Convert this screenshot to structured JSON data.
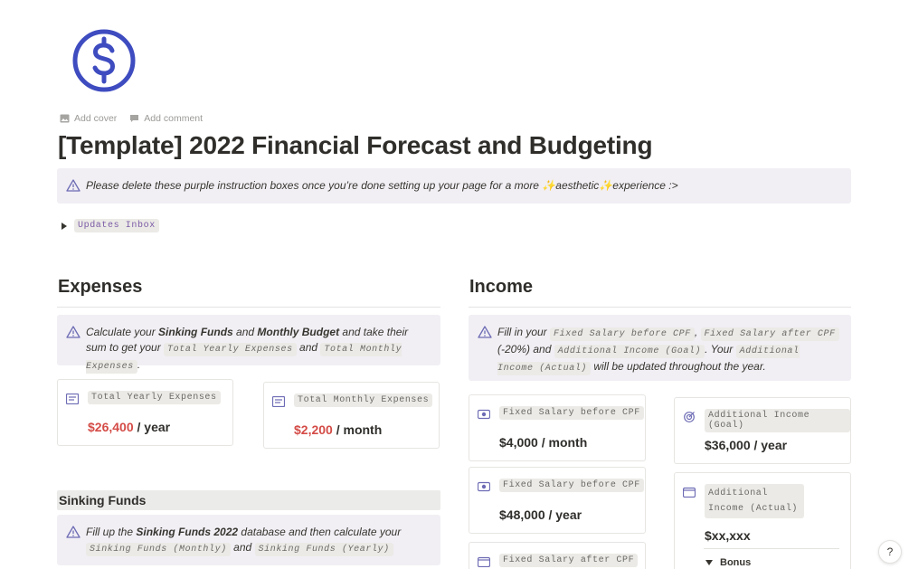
{
  "page": {
    "icon": "dollar-circle-icon",
    "add_cover": "Add cover",
    "add_comment": "Add comment",
    "title": "[Template] 2022 Financial Forecast and Budgeting"
  },
  "top_callout": {
    "icon": "warning-triangle-icon",
    "text_a": "Please delete these purple instruction boxes once you’re done setting up your page for a more ",
    "sparkle_a": "✨",
    "text_b": "aesthetic",
    "sparkle_b": "✨",
    "text_c": "experience :>"
  },
  "toggle": {
    "label": "Updates Inbox"
  },
  "expenses": {
    "heading": "Expenses",
    "callout": {
      "p1": "Calculate your ",
      "b1": "Sinking Funds",
      "p2": " and ",
      "b2": "Monthly Budget",
      "p3": " and take their sum to get your ",
      "c1": "Total Yearly Expenses",
      "p4": " and ",
      "c2": "Total Monthly Expenses",
      "p5": "."
    },
    "cards": [
      {
        "label": "Total Yearly Expenses",
        "amount": "$26,400",
        "unit": " / year",
        "icon": "notes-icon"
      },
      {
        "label": "Total Monthly Expenses",
        "amount": "$2,200",
        "unit": " / month",
        "icon": "notes-icon"
      }
    ]
  },
  "sinking_funds": {
    "heading": "Sinking Funds",
    "callout": {
      "p1": "Fill up the ",
      "b1": "Sinking Funds 2022",
      "p2": " database and then calculate your ",
      "c1": "Sinking Funds (Monthly)",
      "p3": " and ",
      "c2": "Sinking Funds (Yearly)"
    }
  },
  "income": {
    "heading": "Income",
    "callout": {
      "p1": "Fill in your ",
      "c1": "Fixed Salary before CPF",
      "p2": ", ",
      "c2": "Fixed Salary after CPF ",
      "p3": "(-20%) and ",
      "c3": "Additional Income (Goal)",
      "p4": ". Your ",
      "c4": "Additional Income (Actual)",
      "p5": " will be updated throughout the year."
    },
    "cards": [
      {
        "label": "Fixed Salary before CPF",
        "value": "$4,000 / month",
        "icon": "money-icon"
      },
      {
        "label": "Fixed Salary before CPF",
        "value": "$48,000 / year",
        "icon": "money-icon"
      },
      {
        "label": "Fixed Salary after CPF",
        "value": "",
        "icon": "wallet-icon"
      },
      {
        "label": "Additional Income (Goal)",
        "value": "$36,000 / year",
        "icon": "target-icon"
      },
      {
        "label": "Additional Income (Actual)",
        "value": "$xx,xxx",
        "icon": "wallet-icon"
      }
    ],
    "bonus_toggle": "Bonus"
  },
  "help": {
    "label": "?"
  },
  "colors": {
    "accent": "#3e4cc0",
    "callout_bg": "#f1eff4",
    "red": "#d44c47",
    "green": "#448361"
  }
}
